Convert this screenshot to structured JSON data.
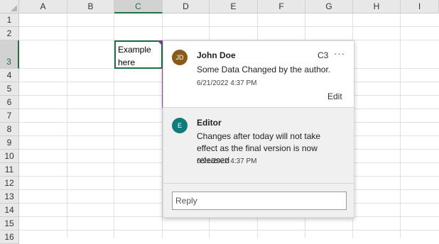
{
  "columns": [
    "A",
    "B",
    "C",
    "D",
    "E",
    "F",
    "G",
    "H",
    "I"
  ],
  "rows": [
    "1",
    "2",
    "3",
    "4",
    "5",
    "6",
    "7",
    "8",
    "9",
    "10",
    "11",
    "12",
    "13",
    "14",
    "15",
    "16"
  ],
  "active_cell": {
    "text": "Example\nhere"
  },
  "thread": {
    "cell_ref": "C3",
    "more_label": "···",
    "comments": [
      {
        "initials": "JD",
        "author": "John Doe",
        "text": "Some Data Changed by the author.",
        "time": "6/21/2022 4:37 PM",
        "avatar_color": "#8b5a18"
      },
      {
        "initials": "E",
        "author": "Editor",
        "text": "Changes after today will not take effect as the final version is now released",
        "time": "6/21/2022 4:37 PM",
        "avatar_color": "#0e7c7b"
      }
    ],
    "edit_label": "Edit",
    "reply_placeholder": "Reply"
  }
}
